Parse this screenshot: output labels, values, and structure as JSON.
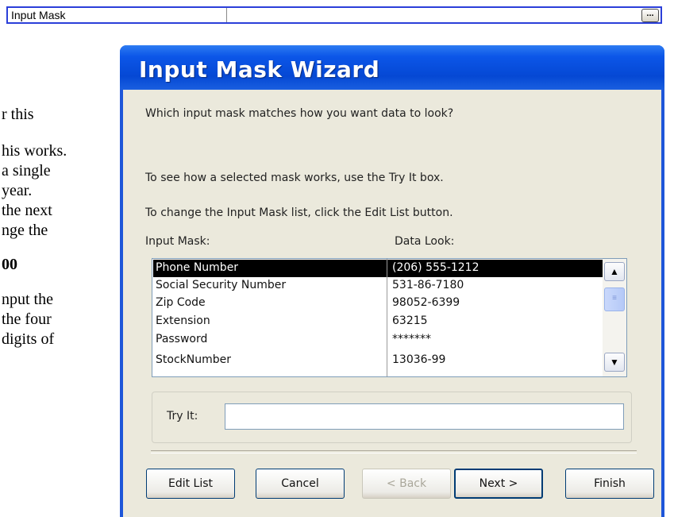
{
  "property_row": {
    "label": "Input Mask",
    "builder_button": "..."
  },
  "background_text": [
    "r this",
    "his works.",
    "a single",
    "year.",
    "the next",
    "nge the",
    "00",
    "nput the",
    "the four",
    "digits of"
  ],
  "wizard": {
    "title": "Input Mask Wizard",
    "question": "Which input mask matches how you want data to look?",
    "try_hint": "To see how a selected mask works, use the Try It box.",
    "edit_hint": "To change the Input Mask list, click the Edit List button.",
    "col_mask_header": "Input Mask:",
    "col_look_header": "Data Look:",
    "rows": [
      {
        "mask": "Phone Number",
        "look": "(206) 555-1212",
        "selected": true
      },
      {
        "mask": "Social Security Number",
        "look": "531-86-7180"
      },
      {
        "mask": "Zip Code",
        "look": "98052-6399"
      },
      {
        "mask": "Extension",
        "look": "63215"
      },
      {
        "mask": "Password",
        "look": "*******"
      },
      {
        "mask": "StockNumber",
        "look": "13036-99"
      }
    ],
    "scroll_up": "▲",
    "scroll_down": "▼",
    "try_label": "Try It:",
    "try_value": "",
    "buttons": {
      "edit_list": "Edit List",
      "cancel": "Cancel",
      "back": "< Back",
      "next": "Next >",
      "finish": "Finish"
    }
  },
  "colors": {
    "title_bar": "#0548d4",
    "dialog_bg": "#ebe9dc",
    "selection": "#000000",
    "property_border": "#2b3fd9"
  }
}
